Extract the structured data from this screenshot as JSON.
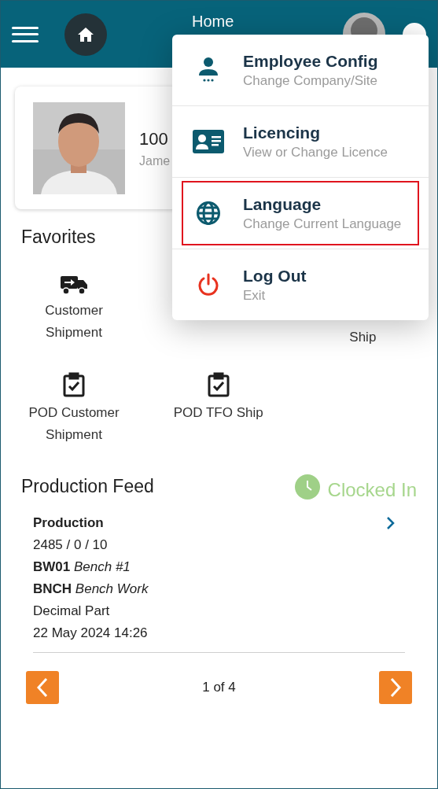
{
  "header": {
    "title": "Home"
  },
  "profile": {
    "number": "100",
    "name": "Jame"
  },
  "favorites": {
    "title": "Favorites",
    "items": [
      {
        "kind": "truck",
        "lines": [
          "Customer",
          "Shipment"
        ]
      },
      {
        "kind": "partly_hidden",
        "lines": [
          "Ship"
        ]
      },
      {
        "kind": "clipboard",
        "lines": [
          "POD Customer",
          "Shipment"
        ]
      },
      {
        "kind": "clipboard",
        "lines": [
          "POD TFO Ship"
        ]
      }
    ]
  },
  "feed": {
    "title": "Production Feed",
    "status": "Clocked In",
    "lines": [
      "**Production**",
      "2485 / 0 / 10",
      "**BW01** *Bench #1*",
      "**BNCH** *Bench Work*",
      "Decimal Part",
      "22 May 2024 14:26"
    ],
    "pager": "1 of 4"
  },
  "menu": {
    "items": [
      {
        "kind": "employee",
        "title": "Employee Config",
        "subtitle": "Change Company/Site",
        "selected": false
      },
      {
        "kind": "licence",
        "title": "Licencing",
        "subtitle": "View or Change Licence",
        "selected": false
      },
      {
        "kind": "globe",
        "title": "Language",
        "subtitle": "Change Current Language",
        "selected": true
      },
      {
        "kind": "power",
        "title": "Log Out",
        "subtitle": "Exit",
        "selected": false
      }
    ]
  }
}
